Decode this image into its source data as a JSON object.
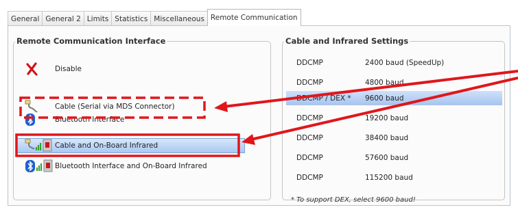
{
  "tabs": [
    "General",
    "General 2",
    "Limits",
    "Statistics",
    "Miscellaneous",
    "Remote Communication"
  ],
  "active_tab": "Remote Communication",
  "interface_group": {
    "title": "Remote Communication Interface",
    "options": [
      {
        "label": "Disable",
        "icon": "x-icon"
      },
      {
        "label": "Cable (Serial via MDS Connector)",
        "icon": "serial-cable-icon"
      },
      {
        "label": "Bluetooth Interface",
        "icon": "bluetooth-icon"
      },
      {
        "label": "Cable and On-Board Infrared",
        "icon": "cable-infrared-icon",
        "selected": true
      },
      {
        "label": "Bluetooth Interface and On-Board Infrared",
        "icon": "bluetooth-infrared-icon"
      }
    ]
  },
  "settings_group": {
    "title": "Cable and Infrared Settings",
    "rows": [
      {
        "protocol": "DDCMP",
        "baud": "2400 baud (SpeedUp)"
      },
      {
        "protocol": "DDCMP",
        "baud": "4800 baud"
      },
      {
        "protocol": "DDCMP / DEX *",
        "baud": "9600 baud",
        "selected": true
      },
      {
        "protocol": "DDCMP",
        "baud": "19200 baud"
      },
      {
        "protocol": "DDCMP",
        "baud": "38400 baud"
      },
      {
        "protocol": "DDCMP",
        "baud": "57600 baud"
      },
      {
        "protocol": "DDCMP",
        "baud": "115200 baud"
      }
    ],
    "note": "* To support DEX, select 9600 baud!"
  },
  "colors": {
    "annotation": "#e0161b",
    "selection": "#a9c8f2",
    "accent_blue": "#1e5fd0"
  }
}
